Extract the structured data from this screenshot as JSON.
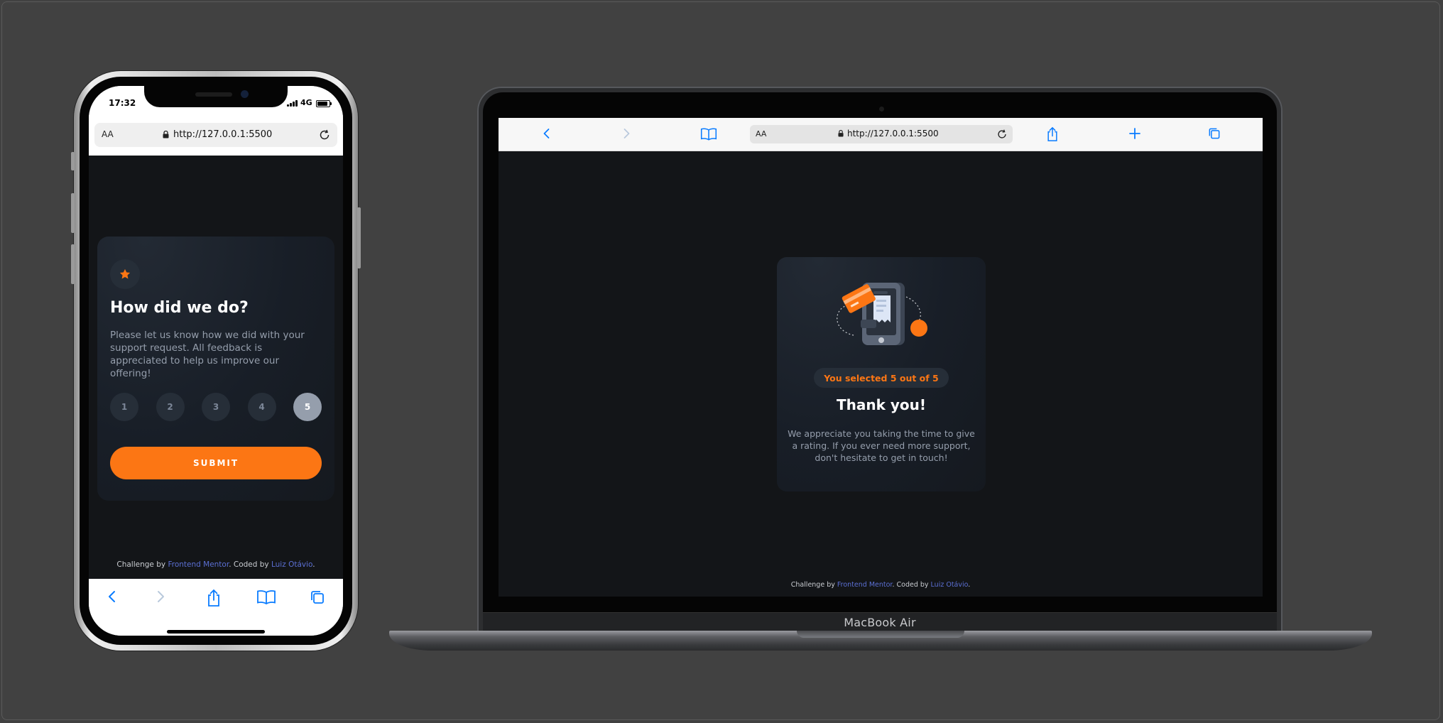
{
  "phone": {
    "status": {
      "time": "17:32",
      "network": "4G"
    },
    "browser": {
      "text_size_label": "AA",
      "url": "http://127.0.0.1:5500"
    },
    "rating_card": {
      "title": "How did we do?",
      "description": "Please let us know how we did with your support request. All feedback is appreciated to help us improve our offering!",
      "options": [
        "1",
        "2",
        "3",
        "4",
        "5"
      ],
      "selected": "5",
      "submit_label": "SUBMIT"
    },
    "attribution": {
      "prefix": "Challenge by ",
      "link1": "Frontend Mentor",
      "middle": ". Coded by ",
      "link2": "Luiz Otávio",
      "suffix": "."
    }
  },
  "laptop": {
    "browser": {
      "text_size_label": "AA",
      "url": "http://127.0.0.1:5500"
    },
    "thankyou_card": {
      "selection_text": "You selected 5 out of 5",
      "title": "Thank you!",
      "description": "We appreciate you taking the time to give a rating. If you ever need more support, don't hesitate to get in touch!"
    },
    "attribution": {
      "prefix": "Challenge by ",
      "link1": "Frontend Mentor",
      "middle": ". Coded by ",
      "link2": "Luiz Otávio",
      "suffix": "."
    },
    "brand": "MacBook Air"
  },
  "colors": {
    "background": "#414141",
    "page_bg": "#131518",
    "accent_orange": "#fc7614",
    "text_gray": "#959eac",
    "link_blue": "#5b6fd3",
    "safari_blue": "#0a7cff"
  },
  "icons": {
    "phone_toolbar": [
      "back-icon",
      "forward-icon",
      "share-icon",
      "bookmarks-icon",
      "tabs-icon"
    ],
    "laptop_toolbar": [
      "back-icon",
      "forward-icon",
      "bookmarks-icon",
      "share-icon",
      "new-tab-icon",
      "tabs-icon"
    ]
  }
}
